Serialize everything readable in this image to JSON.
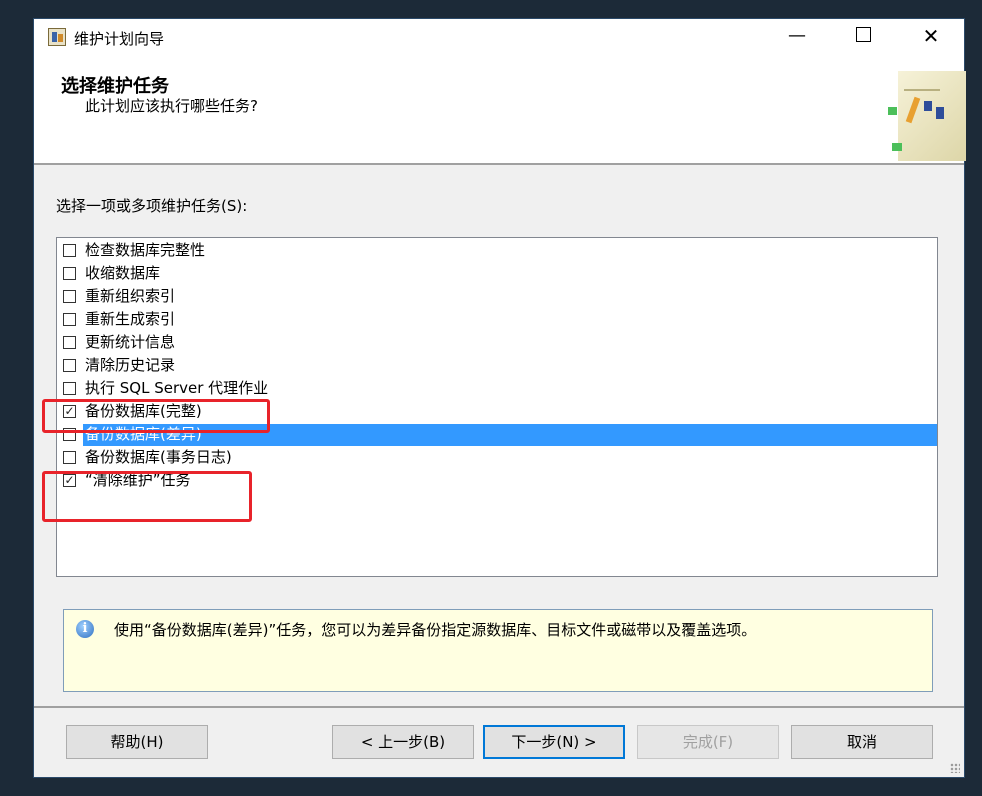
{
  "window": {
    "title": "维护计划向导"
  },
  "header": {
    "title": "选择维护任务",
    "subtitle": "此计划应该执行哪些任务?"
  },
  "prompt_label": "选择一项或多项维护任务(S):",
  "tasks": [
    {
      "label": "检查数据库完整性",
      "checked": false
    },
    {
      "label": "收缩数据库",
      "checked": false
    },
    {
      "label": "重新组织索引",
      "checked": false
    },
    {
      "label": "重新生成索引",
      "checked": false
    },
    {
      "label": "更新统计信息",
      "checked": false
    },
    {
      "label": "清除历史记录",
      "checked": false
    },
    {
      "label": "执行 SQL Server 代理作业",
      "checked": false
    },
    {
      "label": "备份数据库(完整)",
      "checked": true
    },
    {
      "label": "备份数据库(差异)",
      "checked": false,
      "selected": true
    },
    {
      "label": "备份数据库(事务日志)",
      "checked": false
    },
    {
      "label": "“清除维护”任务",
      "checked": true
    }
  ],
  "info": {
    "icon": "info-icon",
    "text": "使用“备份数据库(差异)”任务，您可以为差异备份指定源数据库、目标文件或磁带以及覆盖选项。"
  },
  "buttons": {
    "help": "帮助(H)",
    "prev": "< 上一步(B)",
    "next": "下一步(N) >",
    "finish": "完成(F)",
    "cancel": "取消"
  },
  "colors": {
    "selection": "#3399ff",
    "highlight_box": "#e8232a",
    "info_background": "#ffffe1"
  }
}
